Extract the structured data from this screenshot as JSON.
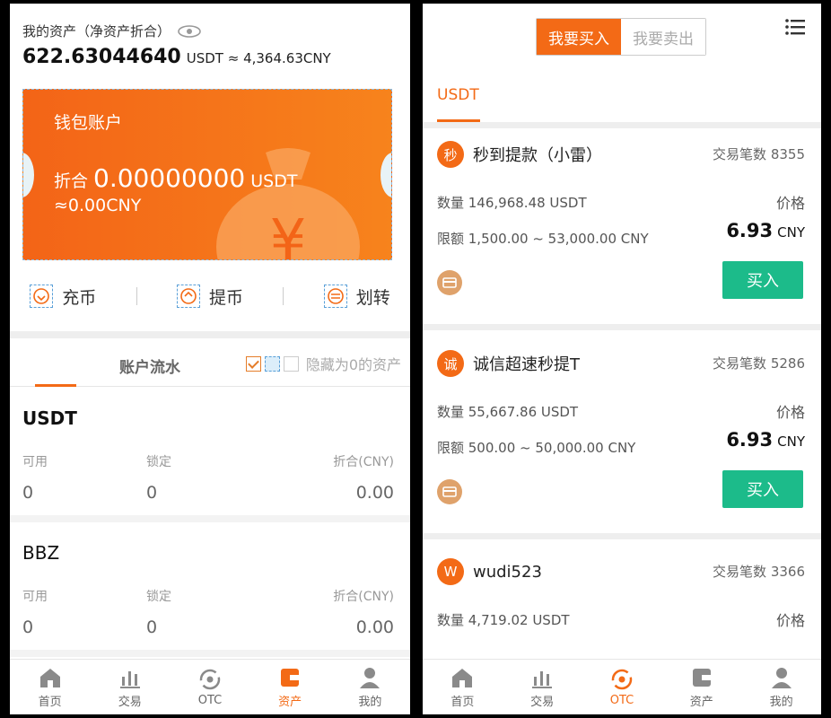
{
  "left": {
    "assets_title": "我的资产（净资产折合）",
    "assets_amount": "622.63044640",
    "assets_unit": "USDT ≈ 4,364.63CNY",
    "wallet": {
      "name": "钱包账户",
      "total_label": "折合",
      "total_value": "0.00000000",
      "total_unit": "USDT",
      "cny": "≈0.00CNY"
    },
    "actions": [
      {
        "label": "充币",
        "icon": "deposit-icon"
      },
      {
        "label": "提币",
        "icon": "withdraw-icon"
      },
      {
        "label": "划转",
        "icon": "transfer-icon"
      }
    ],
    "tab_flow": "账户流水",
    "hide_zero": "隐藏为0的资产",
    "coins": [
      {
        "name": "USDT",
        "h1": "可用",
        "h2": "锁定",
        "h3": "折合(CNY)",
        "v1": "0",
        "v2": "0",
        "v3": "0.00"
      },
      {
        "name": "BBZ",
        "h1": "可用",
        "h2": "锁定",
        "h3": "折合(CNY)",
        "v1": "0",
        "v2": "0",
        "v3": "0.00"
      }
    ],
    "tabbar": [
      {
        "label": "首页",
        "icon": "home-icon"
      },
      {
        "label": "交易",
        "icon": "chart-icon"
      },
      {
        "label": "OTC",
        "icon": "otc-icon"
      },
      {
        "label": "资产",
        "icon": "wallet-icon"
      },
      {
        "label": "我的",
        "icon": "user-icon"
      }
    ],
    "tabbar_active": "资产"
  },
  "right": {
    "buy_tab": "我要买入",
    "sell_tab": "我要卖出",
    "coin_tab": "USDT",
    "ads": [
      {
        "avatar": "秒",
        "merchant": "秒到提款（小雷）",
        "trades": "交易笔数 8355",
        "qty": "数量 146,968.48 USDT",
        "price_label": "价格",
        "limit": "限额 1,500.00 ~ 53,000.00 CNY",
        "price": "6.93",
        "price_unit": "CNY",
        "button": "买入"
      },
      {
        "avatar": "诚",
        "merchant": "诚信超速秒提T",
        "trades": "交易笔数 5286",
        "qty": "数量 55,667.86 USDT",
        "price_label": "价格",
        "limit": "限额 500.00 ~ 50,000.00 CNY",
        "price": "6.93",
        "price_unit": "CNY",
        "button": "买入"
      },
      {
        "avatar": "W",
        "merchant": "wudi523",
        "trades": "交易笔数 3366",
        "qty": "数量 4,719.02 USDT",
        "price_label": "价格"
      }
    ],
    "tabbar": [
      {
        "label": "首页",
        "icon": "home-icon"
      },
      {
        "label": "交易",
        "icon": "chart-icon"
      },
      {
        "label": "OTC",
        "icon": "otc-icon"
      },
      {
        "label": "资产",
        "icon": "wallet-icon"
      },
      {
        "label": "我的",
        "icon": "user-icon"
      }
    ],
    "tabbar_active": "OTC"
  },
  "colors": {
    "accent": "#f36a16",
    "buy_button": "#1cbb8a"
  }
}
